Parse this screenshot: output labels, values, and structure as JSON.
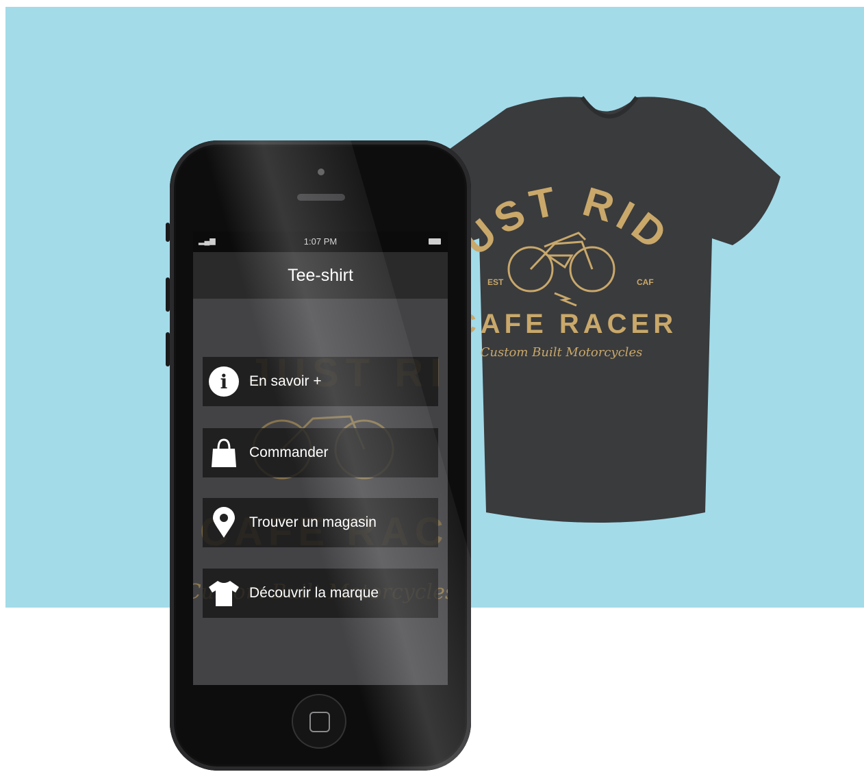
{
  "phone": {
    "status": {
      "time": "1:07 PM"
    },
    "title": "Tee-shirt",
    "menu": [
      {
        "label": "En savoir +",
        "icon": "info-icon"
      },
      {
        "label": "Commander",
        "icon": "shopping-bag-icon"
      },
      {
        "label": "Trouver un magasin",
        "icon": "location-pin-icon"
      },
      {
        "label": "Découvrir la marque",
        "icon": "tshirt-icon"
      }
    ]
  },
  "tshirt_print": {
    "headline": "JUST RIDE",
    "subline": "CAFE RACER",
    "script": "Custom Built Motorcycles",
    "est": "EST",
    "left_badge": "CAF",
    "colors": {
      "ink": "#c9a86a",
      "shirt": "#3a3b3d"
    }
  },
  "colors": {
    "background": "#a3dbe9"
  }
}
